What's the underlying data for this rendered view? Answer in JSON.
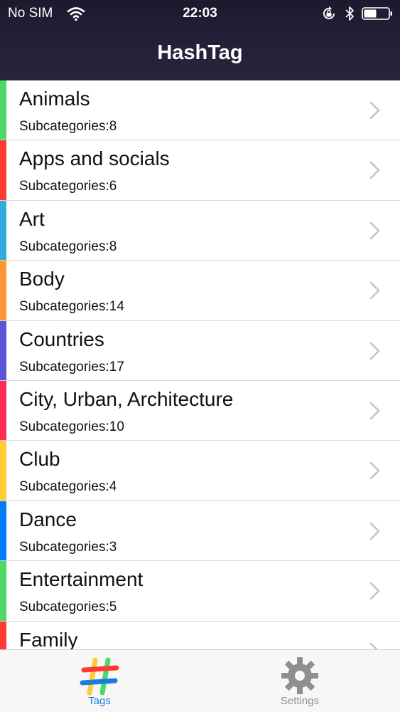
{
  "status_bar": {
    "carrier": "No SIM",
    "time": "22:03",
    "icons": [
      "wifi-icon",
      "orientation-lock-icon",
      "bluetooth-icon",
      "battery-icon"
    ]
  },
  "nav": {
    "title": "HashTag"
  },
  "categories": [
    {
      "name": "Animals",
      "subcategories": "Subcategories:8",
      "color": "#4cd964"
    },
    {
      "name": "Apps and socials",
      "subcategories": "Subcategories:6",
      "color": "#ff3b30"
    },
    {
      "name": "Art",
      "subcategories": "Subcategories:8",
      "color": "#34aadc"
    },
    {
      "name": "Body",
      "subcategories": "Subcategories:14",
      "color": "#ff9533"
    },
    {
      "name": "Countries",
      "subcategories": "Subcategories:17",
      "color": "#5856d6"
    },
    {
      "name": "City, Urban, Architecture",
      "subcategories": "Subcategories:10",
      "color": "#ff2d55"
    },
    {
      "name": "Club",
      "subcategories": "Subcategories:4",
      "color": "#ffcc33"
    },
    {
      "name": "Dance",
      "subcategories": "Subcategories:3",
      "color": "#007aff"
    },
    {
      "name": "Entertainment",
      "subcategories": "Subcategories:5",
      "color": "#4cd964"
    },
    {
      "name": "Family",
      "subcategories": "",
      "color": "#ff3b30"
    }
  ],
  "tabs": [
    {
      "label": "Tags",
      "icon": "hashtag-icon",
      "active": true,
      "color": "#1a7de0"
    },
    {
      "label": "Settings",
      "icon": "gear-icon",
      "active": false,
      "color": "#8f8f8f"
    }
  ]
}
